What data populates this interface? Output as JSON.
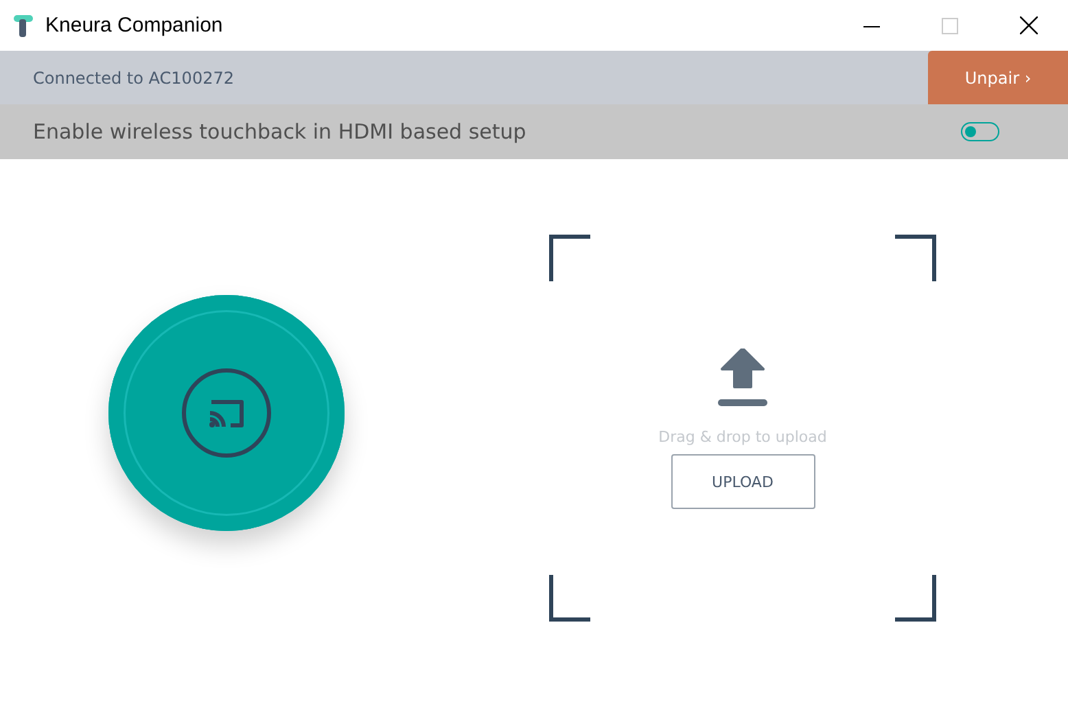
{
  "window": {
    "title": "Kneura Companion"
  },
  "connection": {
    "status": "Connected to AC100272",
    "button": "Unpair ›"
  },
  "touchback": {
    "label": "Enable wireless touchback in HDMI based setup",
    "on": false
  },
  "upload": {
    "hint": "Drag & drop to upload",
    "button": "UPLOAD"
  }
}
